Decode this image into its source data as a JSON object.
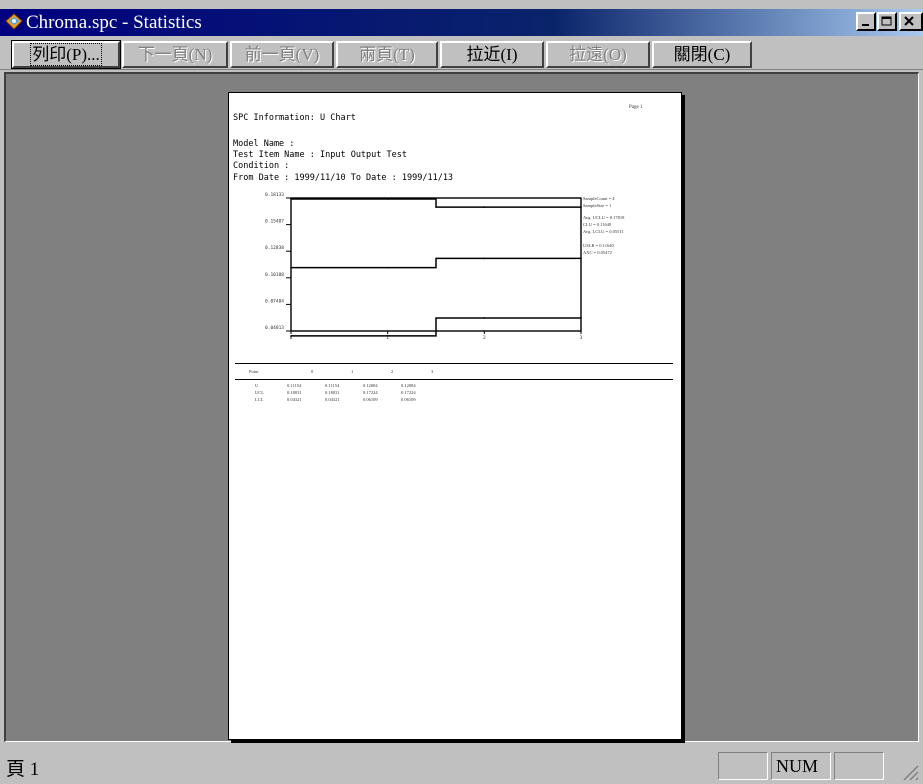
{
  "window": {
    "title": "Chroma.spc - Statistics"
  },
  "toolbar": {
    "buttons": [
      {
        "label": "列印(P)...",
        "enabled": true,
        "default": true
      },
      {
        "label": "下一頁(N)",
        "enabled": false
      },
      {
        "label": "前一頁(V)",
        "enabled": false
      },
      {
        "label": "兩頁(T)",
        "enabled": false
      },
      {
        "label": "拉近(I)",
        "enabled": true
      },
      {
        "label": "拉遠(O)",
        "enabled": false
      },
      {
        "label": "關閉(C)",
        "enabled": true
      }
    ]
  },
  "report": {
    "page_label": "Page 1",
    "header": "SPC Information: U Chart",
    "model_name": "Model Name :",
    "test_item": "Test Item Name : Input Output Test",
    "condition": "Condition :",
    "date_range": "From Date : 1999/11/10   To Date : 1999/11/13",
    "stats": [
      "SampleCount = 4",
      "SampleSize = 1",
      "Avg. UCLU = 0.17818",
      "CLU = 0.11640",
      "Avg. LCLU = 0.05511",
      "USLR = 0.11640",
      "AXC = 0.05472"
    ],
    "table": {
      "header": [
        "Point",
        "0",
        "1",
        "2",
        "3"
      ],
      "rows": [
        [
          "U",
          "0.11154",
          "0.11154",
          "0.12084",
          "0.12084"
        ],
        [
          "UCL",
          "0.18031",
          "0.18031",
          "0.17224",
          "0.17224"
        ],
        [
          "LCL",
          "0.04321",
          "0.04321",
          "0.06109",
          "0.06109"
        ]
      ]
    }
  },
  "chart_data": {
    "type": "line",
    "title": "",
    "x": [
      0,
      1,
      2,
      3
    ],
    "ytick_labels": [
      "0.18133",
      "0.15487",
      "0.12838",
      "0.10188",
      "0.07484",
      "0.04813"
    ],
    "ylim": [
      0.04813,
      0.18133
    ],
    "xlim": [
      0,
      3
    ],
    "series": [
      {
        "values": [
          0.18031,
          0.18031,
          0.17224,
          0.17224
        ]
      },
      {
        "values": [
          0.11154,
          0.11154,
          0.12084,
          0.12084
        ]
      },
      {
        "values": [
          0.04321,
          0.04321,
          0.06109,
          0.06109
        ]
      }
    ]
  },
  "statusbar": {
    "text": "頁 1",
    "num": "NUM"
  }
}
